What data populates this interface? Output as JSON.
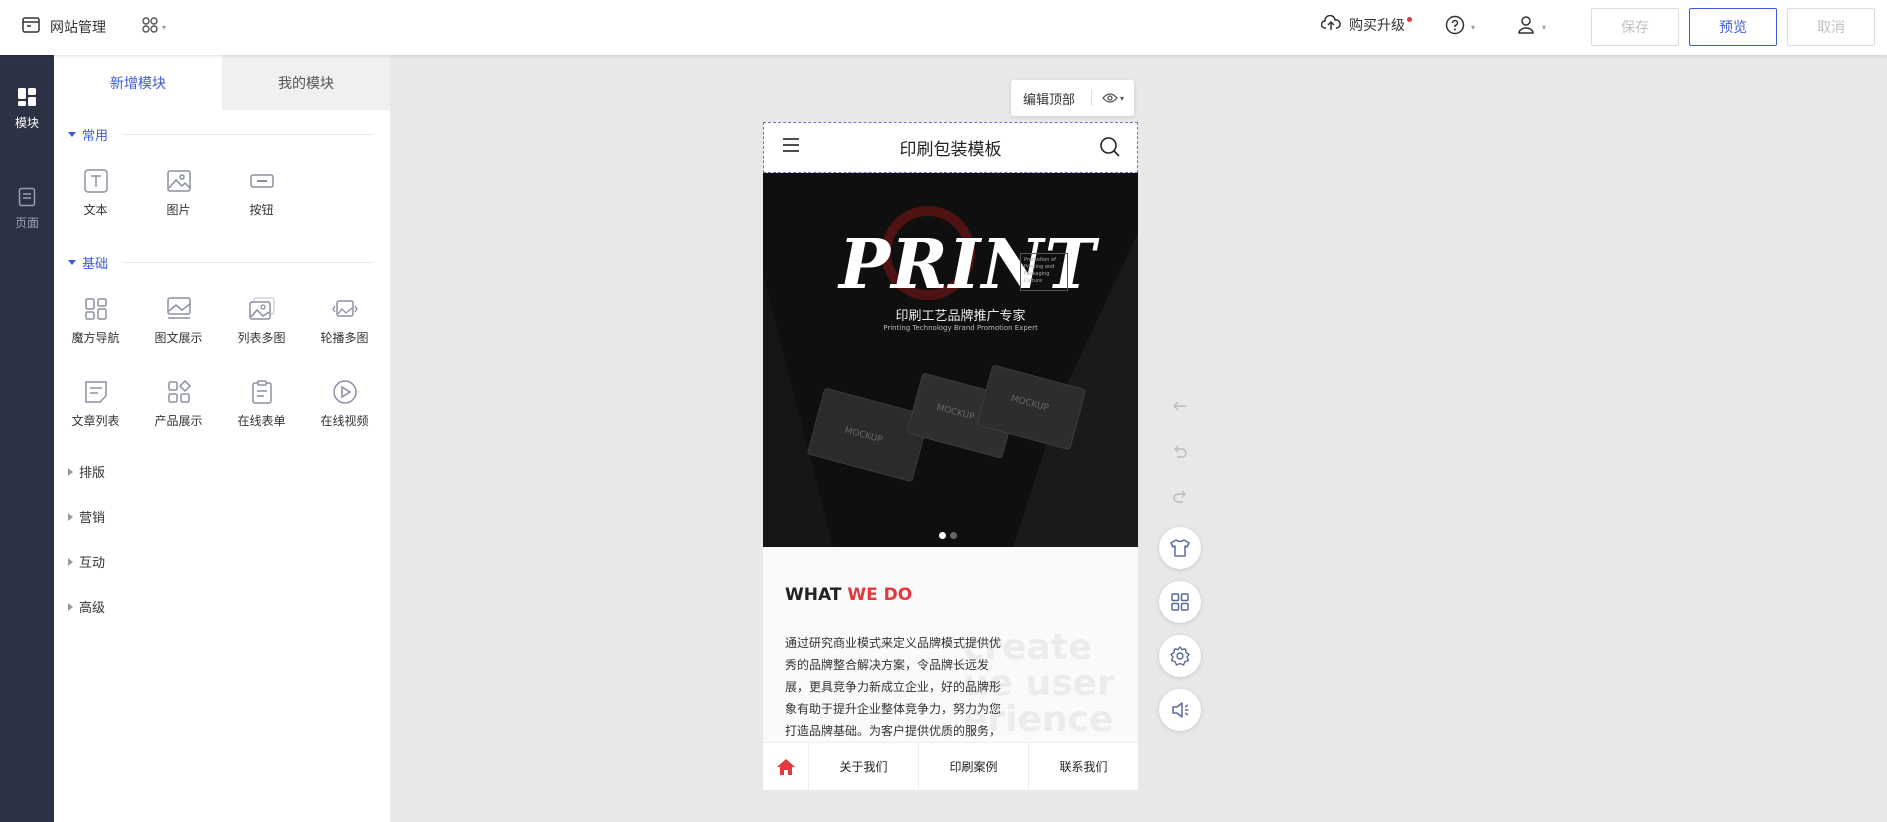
{
  "topbar": {
    "brand_label": "网站管理",
    "upgrade_label": "购买升级",
    "save_label": "保存",
    "preview_label": "预览",
    "cancel_label": "取消"
  },
  "rail": {
    "modules_label": "模块",
    "pages_label": "页面"
  },
  "panel": {
    "tabs": [
      "新增模块",
      "我的模块"
    ],
    "sections": {
      "common": "常用",
      "basic": "基础",
      "layout": "排版",
      "marketing": "营销",
      "interaction": "互动",
      "advanced": "高级"
    },
    "common_items": [
      "文本",
      "图片",
      "按钮"
    ],
    "basic_items": [
      "魔方导航",
      "图文展示",
      "列表多图",
      "轮播多图",
      "文章列表",
      "产品展示",
      "在线表单",
      "在线视频"
    ]
  },
  "canvas": {
    "edit_header_label": "编辑顶部",
    "phone": {
      "title": "印刷包装模板",
      "banner_word": "PRINT",
      "banner_sub": "印刷工艺品牌推广专家",
      "banner_sub_en": "Printing Technology Brand Promotion Expert",
      "banner_promo": "Promotion of Printing and Packaging Culture",
      "section_title_a": "WHAT",
      "section_title_b": "WE DO",
      "bg_text_1": "create",
      "bg_text_2": "ue user",
      "bg_text_3": "erience",
      "paragraph": "通过研究商业模式来定义品牌模式提供优秀的品牌整合解决方案，令品牌长远发展，更具竞争力新成立企业，好的品牌形象有助于提升企业整体竞争力，努力为您打造品牌基础。为客户提供优质的服务，",
      "footer_nav": [
        "关于我们",
        "印刷案例",
        "联系我们"
      ]
    }
  },
  "colors": {
    "accent": "#3d5bd9",
    "rail_bg": "#2c3143",
    "brand_red": "#e4393c"
  }
}
